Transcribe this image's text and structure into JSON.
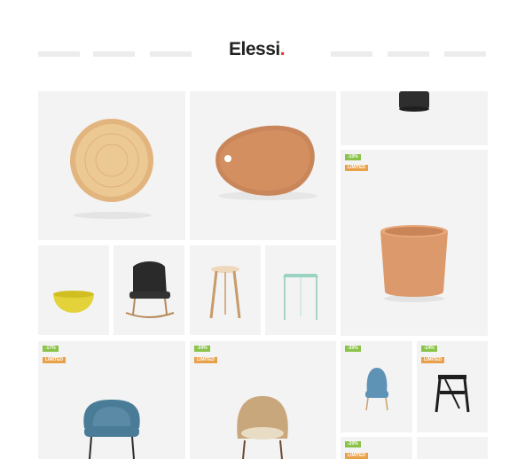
{
  "header": {
    "logo_text": "Elessi",
    "logo_dot": "."
  },
  "nav_items": [
    "",
    "",
    "",
    "",
    "",
    ""
  ],
  "badges": {
    "t_pot": {
      "sale": "-10%",
      "limited": "LIMITED"
    },
    "t_blue_chair_big": {
      "sale": "-17%",
      "limited": "LIMITED"
    },
    "t_tan_chair": {
      "sale": "-24%",
      "limited": "LIMITED"
    },
    "t_blue_chair_small": {
      "sale": "-20%",
      "limited": ""
    },
    "t_black_stool": {
      "sale": "-14%",
      "limited": "LIMITED"
    },
    "t_bottom_small": {
      "sale": "-20%",
      "limited": "LIMITED"
    }
  },
  "colors": {
    "tile_bg": "#f3f3f3",
    "sale_badge": "#8bc34a",
    "limited_badge": "#e8a14a",
    "brand_dot": "#e53935"
  }
}
